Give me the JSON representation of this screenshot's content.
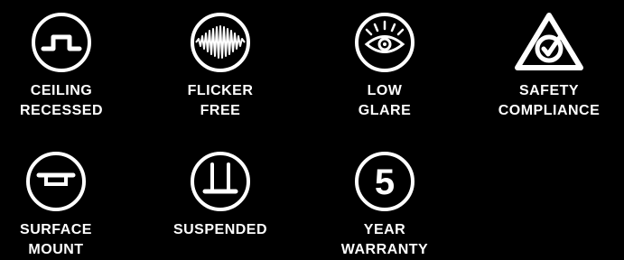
{
  "colors": {
    "background": "#000000",
    "foreground": "#ffffff"
  },
  "features": [
    {
      "icon": "ceiling-recessed-icon",
      "line1": "CEILING",
      "line2": "RECESSED"
    },
    {
      "icon": "flicker-free-icon",
      "line1": "FLICKER",
      "line2": "FREE"
    },
    {
      "icon": "low-glare-eye-icon",
      "line1": "LOW",
      "line2": "GLARE"
    },
    {
      "icon": "safety-compliance-icon",
      "line1": "SAFETY",
      "line2": "COMPLIANCE"
    },
    {
      "icon": "surface-mount-icon",
      "line1": "SURFACE",
      "line2": "MOUNT"
    },
    {
      "icon": "suspended-icon",
      "line1": "SUSPENDED",
      "line2": ""
    },
    {
      "icon": "five-year-warranty-icon",
      "line1": "YEAR",
      "line2": "WARRANTY",
      "badge": "5"
    }
  ]
}
